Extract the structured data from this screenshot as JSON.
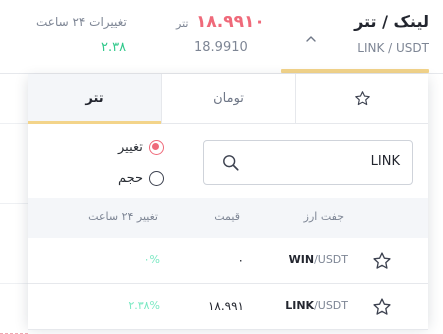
{
  "header": {
    "pair_title": "لینک / تتر",
    "pair_subtitle": "LINK / USDT",
    "price_label": "تتر",
    "price_fa": "۱۸.۹۹۱۰",
    "price_en": "18.9910",
    "change_label": "تغییرات ۲۴ ساعت",
    "change_value": "۲.۳۸",
    "icons": {
      "dropdown": "chevron-up-icon"
    }
  },
  "tabs": [
    {
      "label": "",
      "icon": "star-icon",
      "active": false
    },
    {
      "label": "تومان",
      "active": false
    },
    {
      "label": "تتر",
      "active": true
    }
  ],
  "search": {
    "value": "LINK",
    "icon": "search-icon"
  },
  "sort": {
    "options": [
      {
        "label": "تغییر",
        "checked": true
      },
      {
        "label": "حجم",
        "checked": false
      }
    ]
  },
  "table": {
    "headers": {
      "pair": "جفت ارز",
      "price": "قیمت",
      "change": "تغییر ۲۴ ساعت"
    },
    "rows": [
      {
        "base": "WIN",
        "quote": "/USDT",
        "price": "۰",
        "change": "۰%"
      },
      {
        "base": "LINK",
        "quote": "/USDT",
        "price": "۱۸.۹۹۱",
        "change": "۲.۳۸%"
      }
    ]
  },
  "colors": {
    "accent": "#f3d48a",
    "negative": "#ef6a7a",
    "positive": "#30c98b",
    "positive_light": "#79e8c2",
    "table_header_bg": "#f4f6f9"
  }
}
